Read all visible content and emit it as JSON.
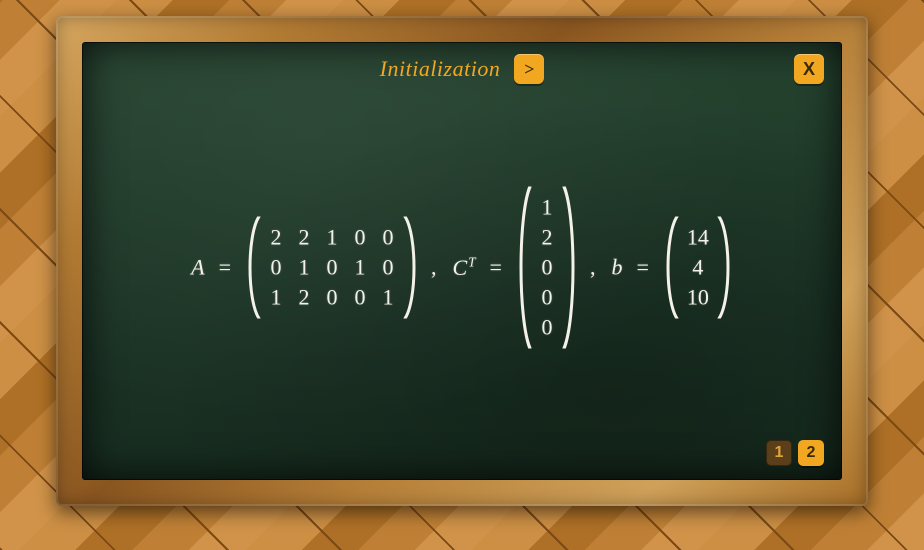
{
  "title": "Initialization",
  "buttons": {
    "next": ">",
    "close": "X"
  },
  "pager": {
    "pages": [
      "1",
      "2"
    ],
    "active_index": 1
  },
  "equation": {
    "A_label": "A",
    "CT_label": "C",
    "CT_sup": "T",
    "b_label": "b",
    "eq": "=",
    "comma": ","
  },
  "matrices": {
    "A": {
      "rows": 3,
      "cols": 5,
      "data": [
        [
          "2",
          "2",
          "1",
          "0",
          "0"
        ],
        [
          "0",
          "1",
          "0",
          "1",
          "0"
        ],
        [
          "1",
          "2",
          "0",
          "0",
          "1"
        ]
      ]
    },
    "CT": {
      "rows": 5,
      "cols": 1,
      "data": [
        [
          "1"
        ],
        [
          "2"
        ],
        [
          "0"
        ],
        [
          "0"
        ],
        [
          "0"
        ]
      ]
    },
    "b": {
      "rows": 3,
      "cols": 1,
      "data": [
        [
          "14"
        ],
        [
          "4"
        ],
        [
          "10"
        ]
      ]
    }
  }
}
